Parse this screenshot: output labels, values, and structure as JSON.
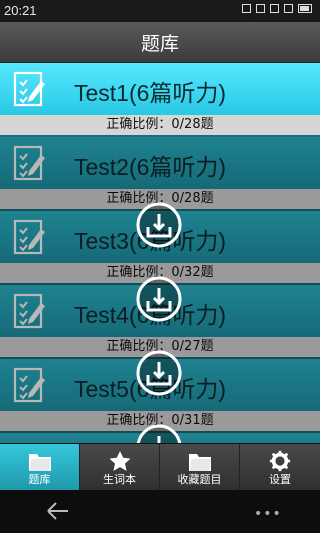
{
  "status": {
    "time": "20:21"
  },
  "header": {
    "title": "题库"
  },
  "items": [
    {
      "title": "Test1(6篇听力)",
      "ratio": "正确比例：0/28题",
      "downloaded": true
    },
    {
      "title": "Test2(6篇听力)",
      "ratio": "正确比例：0/28题",
      "downloaded": false
    },
    {
      "title": "Test3(6篇听力)",
      "ratio": "正确比例：0/32题",
      "downloaded": false
    },
    {
      "title": "Test4(6篇听力)",
      "ratio": "正确比例：0/27题",
      "downloaded": false
    },
    {
      "title": "Test5(6篇听力)",
      "ratio": "正确比例：0/31题",
      "downloaded": false
    }
  ],
  "tabs": [
    {
      "label": "题库",
      "icon": "folder-icon",
      "active": true
    },
    {
      "label": "生词本",
      "icon": "star-icon",
      "active": false
    },
    {
      "label": "收藏题目",
      "icon": "folder-icon",
      "active": false
    },
    {
      "label": "设置",
      "icon": "gear-icon",
      "active": false
    }
  ],
  "nav": {
    "more": "•••"
  }
}
